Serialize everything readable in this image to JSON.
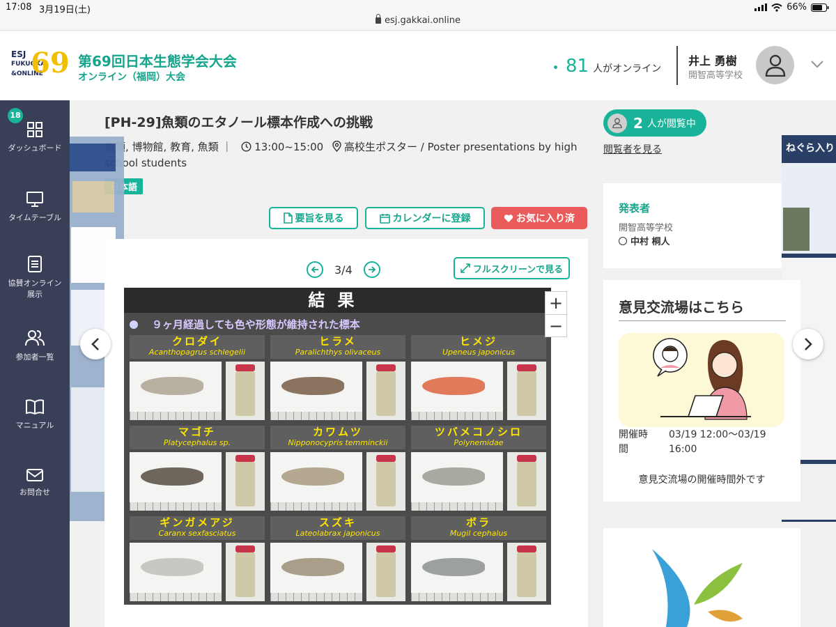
{
  "status": {
    "time": "17:08",
    "date": "3月19日(土)",
    "battery": "66%"
  },
  "browser": {
    "url": "esj.gakkai.online"
  },
  "header": {
    "logo_top": "ESJ",
    "logo_mid": "FUKUOKA",
    "logo_bot": "&ONLINE",
    "logo_num": "69",
    "title": "第69回日本生態学会大会",
    "subtitle": "オンライン（福岡）大会",
    "online_count": "81",
    "online_label": "人がオンライン",
    "user_name": "井上 勇樹",
    "user_org": "開智高等学校"
  },
  "sidebar": {
    "badge": "18",
    "items": [
      {
        "label": "ダッシュボード",
        "icon": "grid-icon"
      },
      {
        "label": "タイムテーブル",
        "icon": "monitor-icon"
      },
      {
        "label": "協賛オンライン展示",
        "icon": "document-icon"
      },
      {
        "label": "参加者一覧",
        "icon": "users-icon"
      },
      {
        "label": "マニュアル",
        "icon": "book-icon"
      },
      {
        "label": "お問合せ",
        "icon": "mail-icon"
      }
    ]
  },
  "poster": {
    "title": "[PH-29]魚類のエタノール標本作成への挑戦",
    "keywords": "魚類, 博物館, 教育, 魚類",
    "time": "13:00~15:00",
    "location": "高校生ポスター / Poster presentations by high school students",
    "language": "日本語",
    "btn_abstract": "要旨を見る",
    "btn_calendar": "カレンダーに登録",
    "btn_favorite": "お気に入り済",
    "page": "3/4",
    "btn_fullscreen": "フルスクリーンで見る",
    "zoom_in": "+",
    "zoom_out": "−"
  },
  "slide": {
    "heading": "結果",
    "subheading": "９ヶ月経過しても色や形態が維持された標本",
    "fish": [
      {
        "jp": "クロダイ",
        "lat": "Acanthopagrus schlegelii",
        "color": "#b8b0a0"
      },
      {
        "jp": "ヒラメ",
        "lat": "Paralichthys olivaceus",
        "color": "#8a7460"
      },
      {
        "jp": "ヒメジ",
        "lat": "Upeneus japonicus",
        "color": "#e07a5a"
      },
      {
        "jp": "マゴチ",
        "lat": "Platycephalus sp.",
        "color": "#6e665c"
      },
      {
        "jp": "カワムツ",
        "lat": "Nipponocypris temminckii",
        "color": "#b5a890"
      },
      {
        "jp": "ツバメコノシロ",
        "lat": "Polynemidae",
        "color": "#a8aaa2"
      },
      {
        "jp": "ギンガメアジ",
        "lat": "Caranx sexfasciatus",
        "color": "#c8c8c2"
      },
      {
        "jp": "スズキ",
        "lat": "Lateolabrax japonicus",
        "color": "#a89e8a"
      },
      {
        "jp": "ボラ",
        "lat": "Mugil cephalus",
        "color": "#9da0a0"
      }
    ]
  },
  "right_thumb": {
    "title": "ねぐら入り"
  },
  "panel": {
    "viewing_count": "2",
    "viewing_label": "人が閲覧中",
    "viewers_link": "閲覧者を見る",
    "presenter_heading": "発表者",
    "presenter_org": "開智高等学校",
    "presenter_name": "中村 桐人",
    "exchange_heading": "意見交流場はこちら",
    "exchange_time_label": "開催時間",
    "exchange_time": "03/19 12:00〜03/19 16:00",
    "exchange_closed": "意見交流場の開催時間外です"
  },
  "colors": {
    "accent": "#19b39a",
    "favorite": "#ea5c5c",
    "sidebar": "#3a3f58"
  }
}
